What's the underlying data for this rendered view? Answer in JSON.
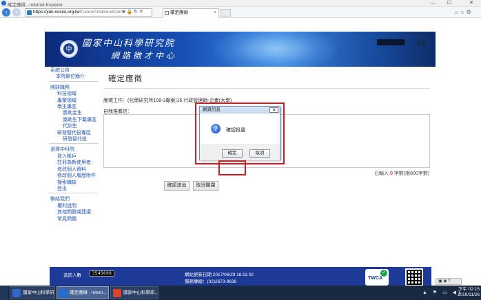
{
  "browser": {
    "window_title": "確定應徵 - Internet Explorer",
    "url_host": "https://join.ncsist.org.tw",
    "url_rest": "/Career/JobSendConfir",
    "tab_title": "確定應徵",
    "tab_close": "×",
    "win_min": "—",
    "win_max": "☐",
    "win_close": "✕",
    "back": "‹",
    "forward": "›",
    "addr_icons": "▾ 🔒 ↻ ✕",
    "right_icons": "⌂ ☆ ⚙"
  },
  "banner": {
    "line1": "國家中山科學研究院",
    "line2": "網路徵才中心",
    "user_box": "",
    "logout": "登出"
  },
  "sidebar": {
    "groups": [
      {
        "title": "系統公告",
        "items": [
          {
            "label": "本院單位簡介",
            "level": 1
          }
        ]
      },
      {
        "title": "開缺職務",
        "items": [
          {
            "label": "科技領域",
            "level": 2
          },
          {
            "label": "專業領域",
            "level": 2
          },
          {
            "label": "學生專區",
            "level": 2
          },
          {
            "label": "獎助金生",
            "level": 3
          },
          {
            "label": "獎助生下載專區",
            "level": 3
          },
          {
            "label": "代訓生",
            "level": 3
          },
          {
            "label": "研發替代役專區",
            "level": 2
          },
          {
            "label": "研發替代役",
            "level": 3
          }
        ]
      },
      {
        "title": "選擇中科院",
        "items": [
          {
            "label": "登入帳戶",
            "level": 2
          },
          {
            "label": "註冊為新使用者",
            "level": 2
          },
          {
            "label": "修改個人資料",
            "level": 2
          },
          {
            "label": "修改個人履歷附件",
            "level": 2
          },
          {
            "label": "搜索職缺",
            "level": 2
          },
          {
            "label": "登出",
            "level": 2
          }
        ]
      },
      {
        "title": "聯絡我們",
        "items": [
          {
            "label": "權利說明",
            "level": 2
          },
          {
            "label": "其他問題或建議",
            "level": 2
          },
          {
            "label": "常見問題",
            "level": 2
          }
        ]
      }
    ]
  },
  "main": {
    "title": "確定應徵",
    "apply_job": "應徵工作：(化學研究所108-3專案)16.行政管理師-企畫(大學)",
    "recommend_label": "自我推薦信：",
    "counter_prefix": "已輸入",
    "counter_value": "0",
    "counter_suffix": "字數(限800字數)",
    "confirm_button": "確認送出",
    "cancel_button": "取消關閉"
  },
  "dialog": {
    "title": "網頁訊息",
    "close": "✕",
    "icon_glyph": "?",
    "message": "確認投遞",
    "ok": "確定",
    "cancel": "取消"
  },
  "footer": {
    "visit_label": "造訪人數",
    "visit_count": "3545608",
    "updated": "網站更新日期 2017/06/29 18:11:02",
    "phone": "服務專線：(02)2673-9638",
    "twca": "TWCA"
  },
  "taskbar": {
    "tasks": [
      {
        "label": "國家中山科學研...",
        "active": false,
        "color": "#2f67c8"
      },
      {
        "label": "確定應徵 - Intern...",
        "active": true,
        "color": "#1e6fd0"
      },
      {
        "label": "國家中山科學研...",
        "active": false,
        "color": "#d9442f"
      }
    ],
    "tray": "▲ ⚑ ▭ ◀)",
    "time": "下午 02:15",
    "date": "2019/11/26",
    "lang": "▣ ◉ ?"
  },
  "colors": {
    "accent": "#1f55b0",
    "highlight": "#e0141a",
    "footer_bg": "#1d3a96"
  }
}
